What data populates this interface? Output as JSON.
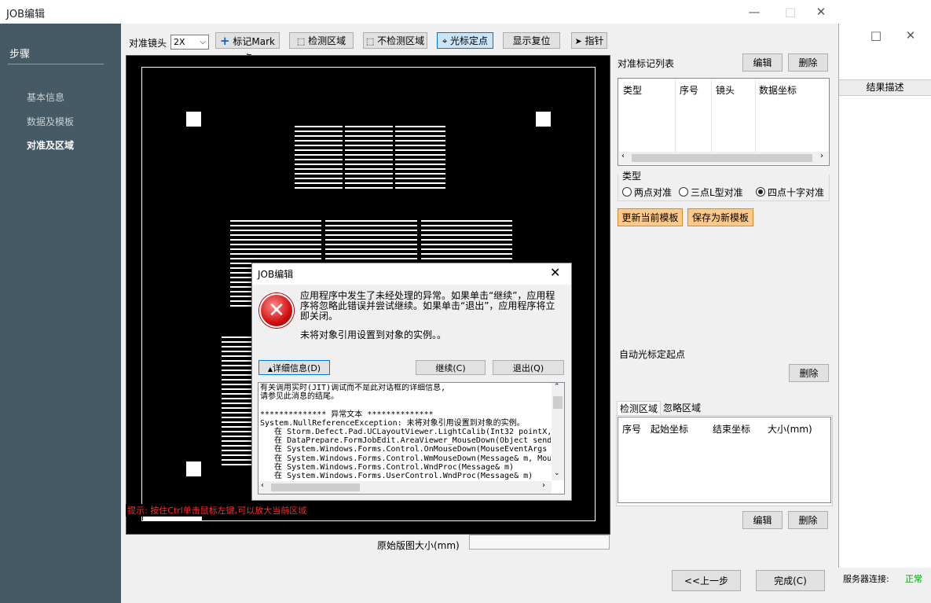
{
  "window": {
    "title": "JOB编辑",
    "min": "—",
    "max": "□",
    "close": "✕"
  },
  "sidebar": {
    "title": "步骤",
    "items": [
      {
        "label": "基本信息",
        "active": false
      },
      {
        "label": "数据及模板",
        "active": false
      },
      {
        "label": "对准及区域",
        "active": true
      }
    ]
  },
  "toolbar": {
    "lens_label": "对准镜头",
    "lens_value": "2X",
    "mark_point": "标记Mark点",
    "detect_region": "检测区域",
    "no_detect_region": "不检测区域",
    "cursor_position": "光标定点",
    "display_reset": "显示复位",
    "pointer": "指针"
  },
  "canvas": {
    "hint": "提示: 按住Ctrl单击鼠标左键,可以放大当前区域",
    "size_label": "原始版图大小(mm)",
    "size_value": ""
  },
  "align_marks": {
    "title": "对准标记列表",
    "edit": "编辑",
    "delete": "删除",
    "columns": [
      "类型",
      "序号",
      "镜头",
      "数据坐标"
    ]
  },
  "type_group": {
    "title": "类型",
    "options": [
      "两点对准",
      "三点L型对准",
      "四点十字对准"
    ],
    "selected": 2
  },
  "template_buttons": {
    "update": "更新当前模板",
    "save_new": "保存为新模板"
  },
  "auto_cursor": {
    "title": "自动光标定起点",
    "delete": "删除"
  },
  "regions": {
    "tabs": [
      "检测区域",
      "忽略区域"
    ],
    "columns": [
      "序号",
      "起始坐标",
      "结束坐标",
      "大小(mm)"
    ],
    "edit": "编辑",
    "delete": "删除"
  },
  "footer": {
    "prev": "<<上一步",
    "finish": "完成(C)"
  },
  "second_window": {
    "max": "□",
    "close": "✕",
    "header": "结果描述",
    "status_label": "服务器连接:",
    "status_value": "正常",
    "status_color": "#00a000"
  },
  "dialog": {
    "title": "JOB编辑",
    "close": "✕",
    "message": "应用程序中发生了未经处理的异常。如果单击“继续”，应用程序将忽略此错误并尝试继续。如果单击“退出”，应用程序将立即关闭。",
    "message2": "未将对象引用设置到对象的实例。。",
    "details_button": "详细信息(D)",
    "continue_button": "继续(C)",
    "quit_button": "退出(Q)",
    "details_text": "有关调用实时(JIT)调试而不是此对话框的详细信息,\n请参见此消息的结尾。\n\n************** 异常文本 **************\nSystem.NullReferenceException: 未将对象引用设置到对象的实例。\n   在 Storm.Defect.Pad.UCLayoutViewer.LightCalib(Int32 pointX, Int\n   在 DataPrepare.FormJobEdit.AreaViewer_MouseDown(Object sender, \n   在 System.Windows.Forms.Control.OnMouseDown(MouseEventArgs e)\n   在 System.Windows.Forms.Control.WmMouseDown(Message& m, MouseBu\n   在 System.Windows.Forms.Control.WndProc(Message& m)\n   在 System.Windows.Forms.UserControl.WndProc(Message& m)"
  }
}
